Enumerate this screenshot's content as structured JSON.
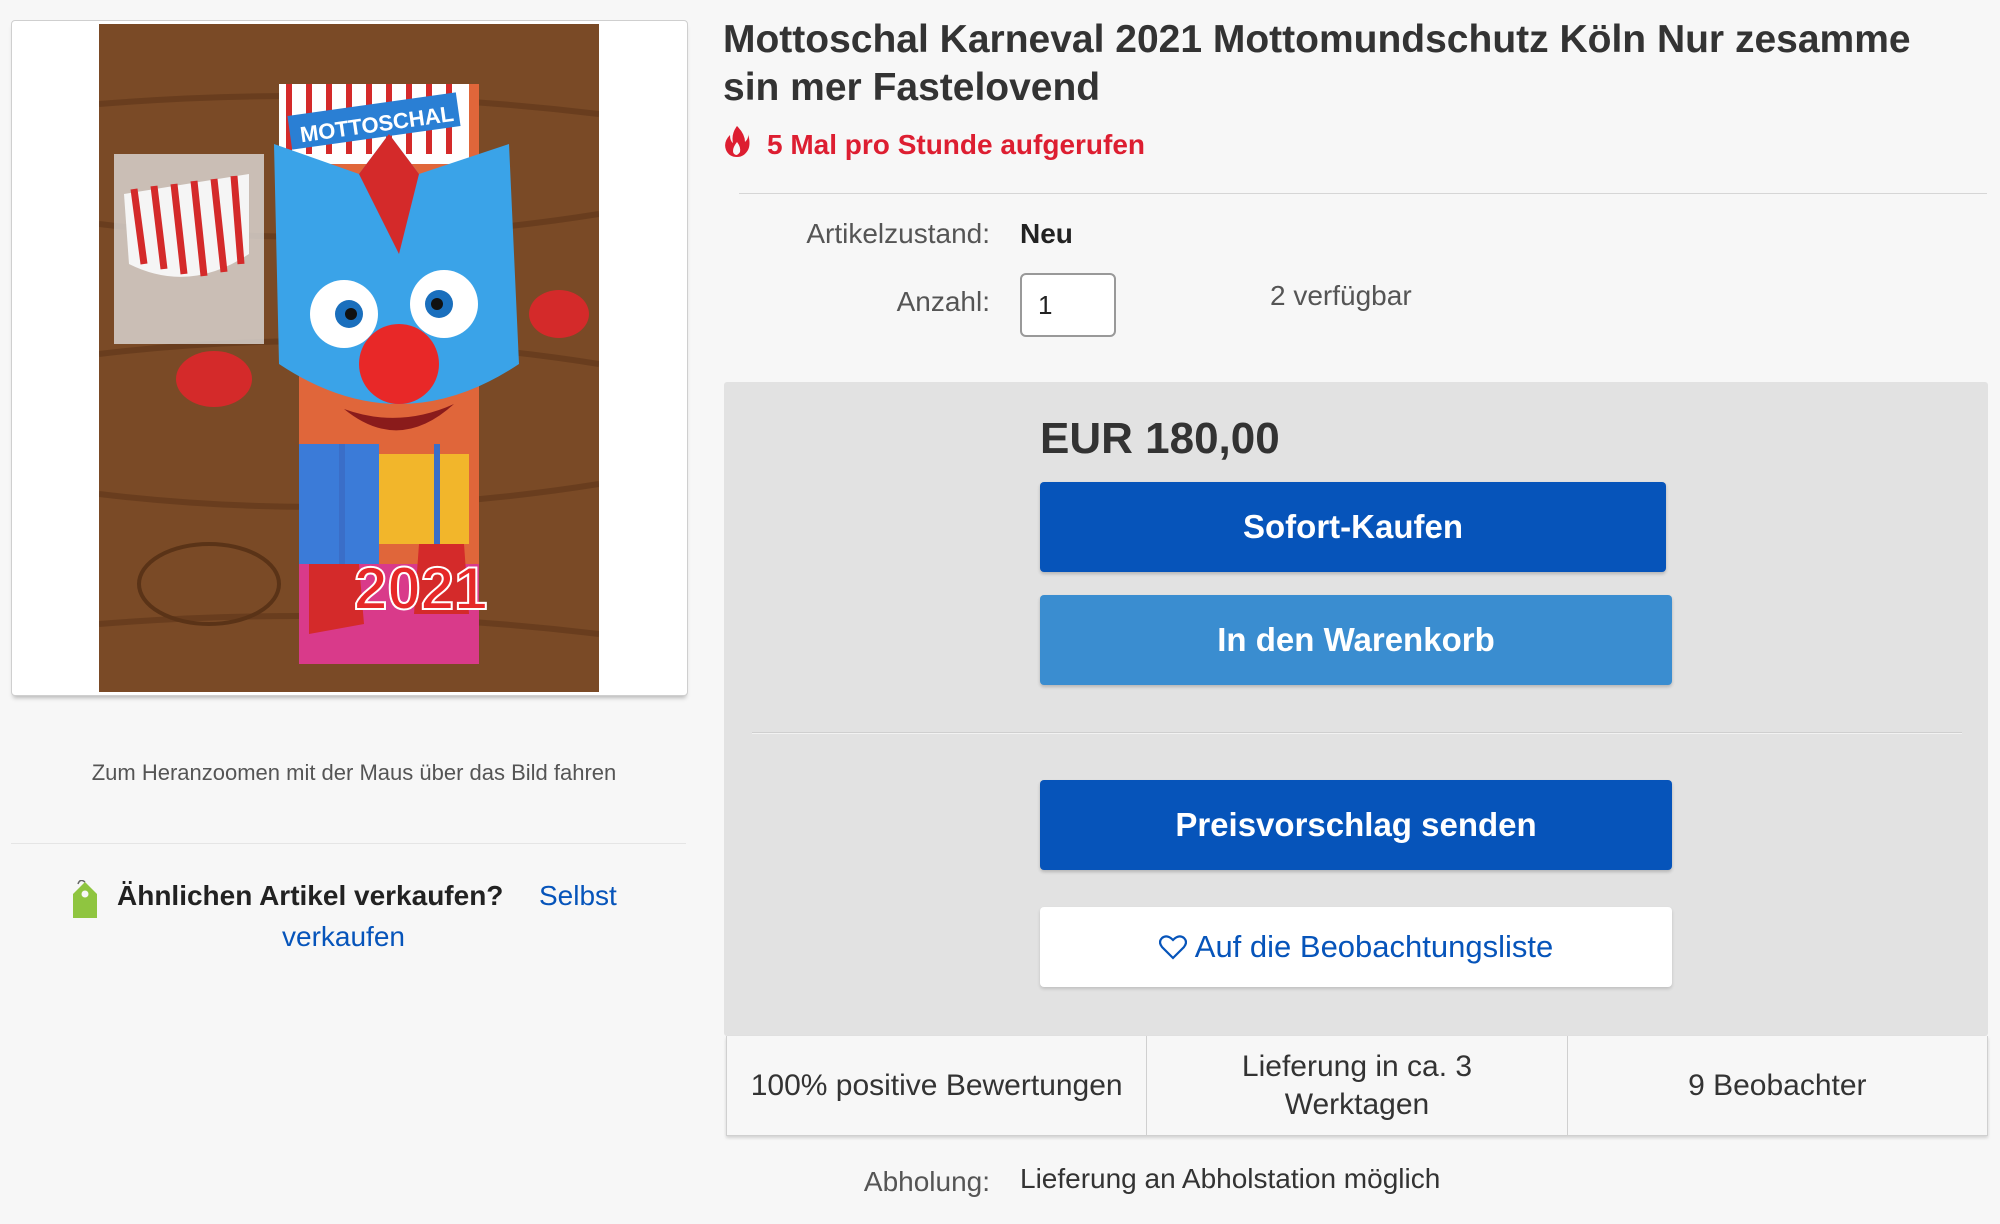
{
  "gallery": {
    "zoom_hint": "Zum Heranzoomen mit der Maus über das Bild fahren",
    "sell_question": "Ähnlichen Artikel verkaufen?",
    "sell_link_part1": "Selbst",
    "sell_link_part2": "verkaufen",
    "photo_text_top": "MOTTOSCHAL",
    "photo_text_year": "2021"
  },
  "item": {
    "title": "Mottoschal Karneval 2021 Mottomundschutz Köln Nur zesamme sin mer Fastelovend",
    "views": "5 Mal pro Stunde aufgerufen",
    "condition_label": "Artikelzustand:",
    "condition_value": "Neu",
    "quantity_label": "Anzahl:",
    "quantity_value": "1",
    "available": "2 verfügbar",
    "pickup_label": "Abholung:",
    "pickup_value": "Lieferung an Abholstation möglich"
  },
  "buybox": {
    "price": "EUR 180,00",
    "buy_now": "Sofort-Kaufen",
    "add_to_cart": "In den Warenkorb",
    "make_offer": "Preisvorschlag senden",
    "watch": "Auf die Beobachtungsliste"
  },
  "stats": {
    "feedback": "100% positive Bewertungen",
    "delivery": "Lieferung in ca. 3 Werktagen",
    "watchers": "9 Beobachter"
  },
  "colors": {
    "primary_button": "#0654ba",
    "secondary_button": "#3a8dd0",
    "views_red": "#dd1e31",
    "link_blue": "#0654ba"
  },
  "icons": [
    "fire-icon",
    "heart-icon",
    "price-tag-icon"
  ]
}
